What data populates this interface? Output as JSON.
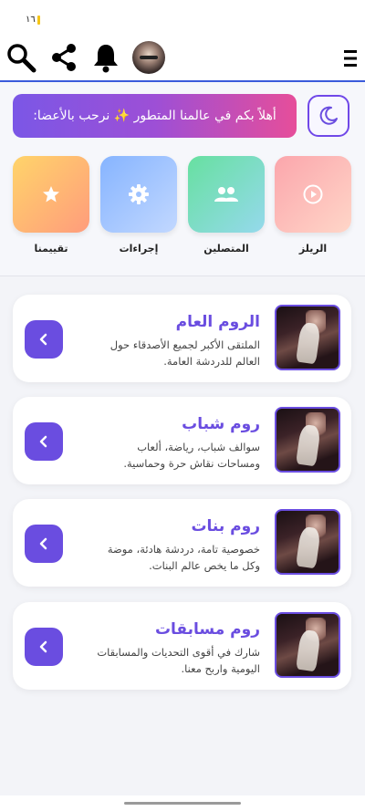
{
  "status": {
    "time": "١٦",
    "battery_color": "#f5c518"
  },
  "header": {
    "icons": [
      "search-icon",
      "share-icon",
      "bell-icon",
      "avatar",
      "menu-icon"
    ],
    "accent": "#3b5bdb"
  },
  "banner": {
    "text": "أهلاً بكم في عالمنا المتطور ✨ نرحب بالأعضا:"
  },
  "theme_toggle": {
    "icon": "moon-icon"
  },
  "quick_actions": [
    {
      "label": "الريلز",
      "icon": "play-icon",
      "colors": [
        "#fbb0b4",
        "#ffd2c6"
      ]
    },
    {
      "label": "المتصلين",
      "icon": "users-icon",
      "colors": [
        "#6fe0a4",
        "#8fdce6"
      ]
    },
    {
      "label": "إجراءات",
      "icon": "gear-icon",
      "colors": [
        "#8fb8ff",
        "#b9d3ff"
      ]
    },
    {
      "label": "تقييمنا",
      "icon": "star-icon",
      "colors": [
        "#ffcf6e",
        "#ff9f7a"
      ]
    }
  ],
  "rooms": [
    {
      "title": "الروم العام",
      "description": "الملتقى الأكبر لجميع الأصدقاء حول العالم للدردشة العامة."
    },
    {
      "title": "روم شباب",
      "description": "سوالف شباب، رياضة، ألعاب ومساحات نقاش حرة وحماسية."
    },
    {
      "title": "روم بنات",
      "description": "خصوصية تامة، دردشة هادئة، موضة وكل ما يخص عالم البنات."
    },
    {
      "title": "روم مسابقات",
      "description": "شارك في أقوى التحديات والمسابقات اليومية واربح معنا."
    }
  ],
  "colors": {
    "primary": "#6a4de0",
    "banner_start": "#7b57e6",
    "banner_end": "#e64e9a"
  }
}
